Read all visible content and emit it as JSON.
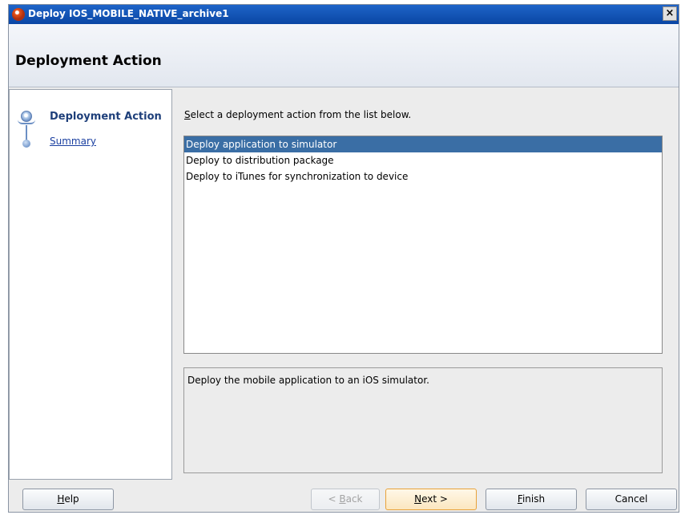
{
  "window": {
    "title": "Deploy IOS_MOBILE_NATIVE_archive1",
    "close_glyph": "×"
  },
  "header": {
    "title": "Deployment Action"
  },
  "steps": [
    {
      "label": "Deployment Action",
      "active": true
    },
    {
      "label": "Summary",
      "active": false
    }
  ],
  "instruction": {
    "mnemonic": "S",
    "rest": "elect a deployment action from the list below."
  },
  "actions": {
    "selected_index": 0,
    "items": [
      "Deploy application to simulator",
      "Deploy to distribution package",
      "Deploy to iTunes for synchronization to device"
    ]
  },
  "description": "Deploy the mobile application to an iOS simulator.",
  "buttons": {
    "help": {
      "mnemonic": "H",
      "rest": "elp"
    },
    "back": {
      "prefix": "< ",
      "mnemonic": "B",
      "rest": "ack",
      "enabled": false
    },
    "next": {
      "mnemonic": "N",
      "rest": "ext >"
    },
    "finish": {
      "mnemonic": "F",
      "rest": "inish"
    },
    "cancel": {
      "label": "Cancel"
    }
  },
  "colors": {
    "selection": "#3a6ea5",
    "titlebar": "#0a46a4",
    "default_button_border": "#e8a23a"
  }
}
